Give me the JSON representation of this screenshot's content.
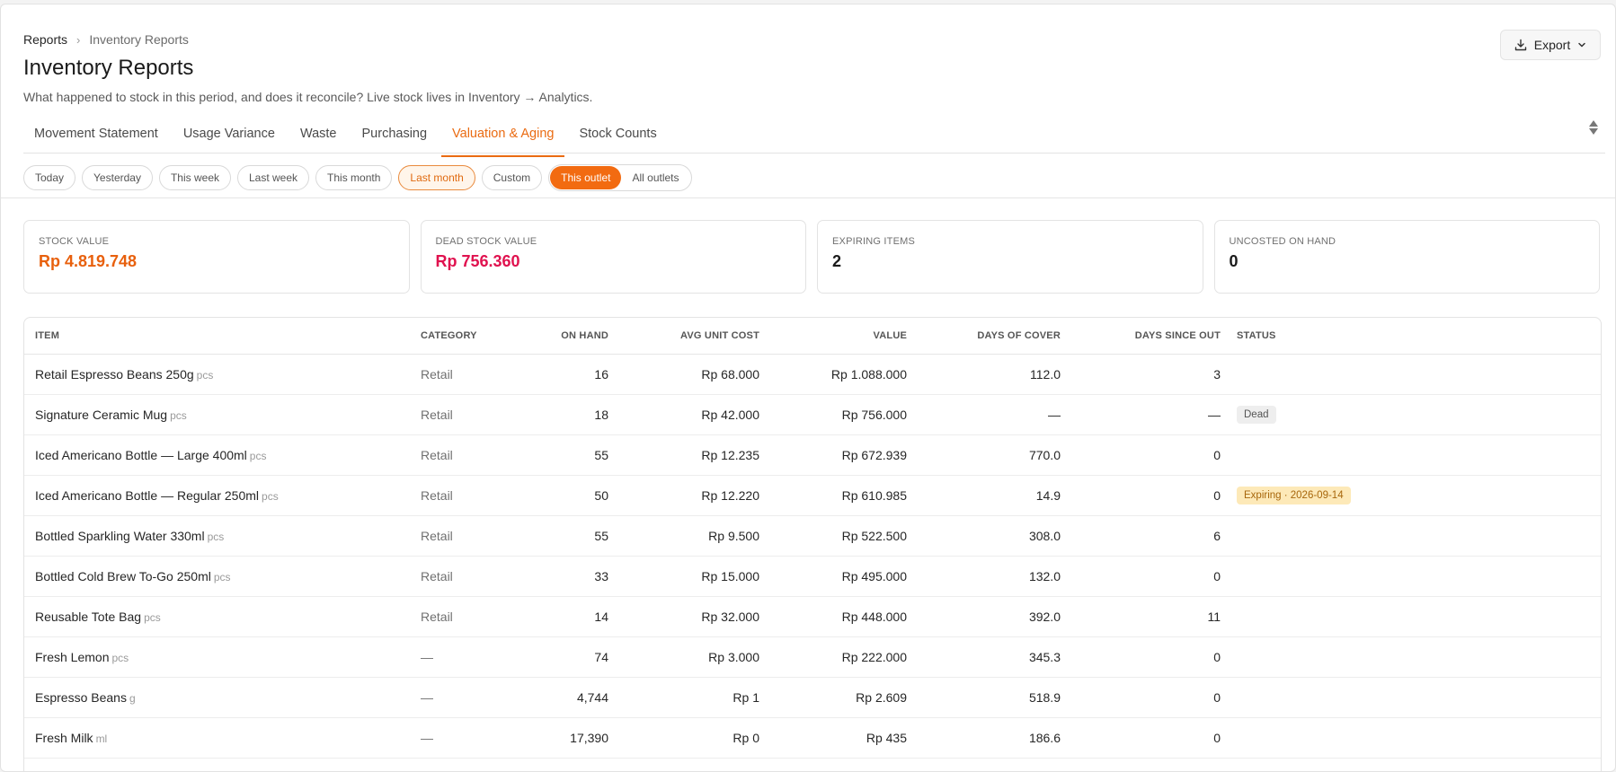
{
  "breadcrumb": {
    "parent": "Reports",
    "current": "Inventory Reports"
  },
  "page": {
    "title": "Inventory Reports",
    "subtitle": "What happened to stock in this period, and does it reconcile? Live stock lives in Inventory → Analytics."
  },
  "export": {
    "label": "Export",
    "icon": "download-icon"
  },
  "tabs": [
    {
      "label": "Movement Statement",
      "active": false
    },
    {
      "label": "Usage Variance",
      "active": false
    },
    {
      "label": "Waste",
      "active": false
    },
    {
      "label": "Purchasing",
      "active": false
    },
    {
      "label": "Valuation & Aging",
      "active": true
    },
    {
      "label": "Stock Counts",
      "active": false
    }
  ],
  "date_filters": [
    {
      "label": "Today",
      "selected": false
    },
    {
      "label": "Yesterday",
      "selected": false
    },
    {
      "label": "This week",
      "selected": false
    },
    {
      "label": "Last week",
      "selected": false
    },
    {
      "label": "This month",
      "selected": false
    },
    {
      "label": "Last month",
      "selected": true
    },
    {
      "label": "Custom",
      "selected": false
    }
  ],
  "scope": [
    {
      "label": "This outlet",
      "active": true
    },
    {
      "label": "All outlets",
      "active": false
    }
  ],
  "kpis": [
    {
      "label": "STOCK VALUE",
      "value": "Rp 4.819.748",
      "color": "#e8600d"
    },
    {
      "label": "DEAD STOCK VALUE",
      "value": "Rp 756.360",
      "color": "#e0124f"
    },
    {
      "label": "EXPIRING ITEMS",
      "value": "2",
      "color": "#1a1a1a"
    },
    {
      "label": "UNCOSTED ON HAND",
      "value": "0",
      "color": "#1a1a1a"
    }
  ],
  "table": {
    "columns": {
      "item": "ITEM",
      "category": "CATEGORY",
      "on_hand": "ON HAND",
      "avg_unit_cost": "AVG UNIT COST",
      "value": "VALUE",
      "days_of_cover": "DAYS OF COVER",
      "days_since_out": "DAYS SINCE OUT",
      "status": "STATUS"
    },
    "rows": [
      {
        "item": "Retail Espresso Beans 250g",
        "unit": "pcs",
        "category": "Retail",
        "on_hand": "16",
        "avg_unit_cost": "Rp 68.000",
        "value": "Rp 1.088.000",
        "days_of_cover": "112.0",
        "days_since_out": "3",
        "status": "",
        "status_type": ""
      },
      {
        "item": "Signature Ceramic Mug",
        "unit": "pcs",
        "category": "Retail",
        "on_hand": "18",
        "avg_unit_cost": "Rp 42.000",
        "value": "Rp 756.000",
        "days_of_cover": "—",
        "days_since_out": "—",
        "status": "Dead",
        "status_type": "dead"
      },
      {
        "item": "Iced Americano Bottle — Large 400ml",
        "unit": "pcs",
        "category": "Retail",
        "on_hand": "55",
        "avg_unit_cost": "Rp 12.235",
        "value": "Rp 672.939",
        "days_of_cover": "770.0",
        "days_since_out": "0",
        "status": "",
        "status_type": ""
      },
      {
        "item": "Iced Americano Bottle — Regular 250ml",
        "unit": "pcs",
        "category": "Retail",
        "on_hand": "50",
        "avg_unit_cost": "Rp 12.220",
        "value": "Rp 610.985",
        "days_of_cover": "14.9",
        "days_since_out": "0",
        "status": "Expiring · 2026-09-14",
        "status_type": "expiring"
      },
      {
        "item": "Bottled Sparkling Water 330ml",
        "unit": "pcs",
        "category": "Retail",
        "on_hand": "55",
        "avg_unit_cost": "Rp 9.500",
        "value": "Rp 522.500",
        "days_of_cover": "308.0",
        "days_since_out": "6",
        "status": "",
        "status_type": ""
      },
      {
        "item": "Bottled Cold Brew To-Go 250ml",
        "unit": "pcs",
        "category": "Retail",
        "on_hand": "33",
        "avg_unit_cost": "Rp 15.000",
        "value": "Rp 495.000",
        "days_of_cover": "132.0",
        "days_since_out": "0",
        "status": "",
        "status_type": ""
      },
      {
        "item": "Reusable Tote Bag",
        "unit": "pcs",
        "category": "Retail",
        "on_hand": "14",
        "avg_unit_cost": "Rp 32.000",
        "value": "Rp 448.000",
        "days_of_cover": "392.0",
        "days_since_out": "11",
        "status": "",
        "status_type": ""
      },
      {
        "item": "Fresh Lemon",
        "unit": "pcs",
        "category": "—",
        "on_hand": "74",
        "avg_unit_cost": "Rp 3.000",
        "value": "Rp 222.000",
        "days_of_cover": "345.3",
        "days_since_out": "0",
        "status": "",
        "status_type": ""
      },
      {
        "item": "Espresso Beans",
        "unit": "g",
        "category": "—",
        "on_hand": "4,744",
        "avg_unit_cost": "Rp 1",
        "value": "Rp 2.609",
        "days_of_cover": "518.9",
        "days_since_out": "0",
        "status": "",
        "status_type": ""
      },
      {
        "item": "Fresh Milk",
        "unit": "ml",
        "category": "—",
        "on_hand": "17,390",
        "avg_unit_cost": "Rp 0",
        "value": "Rp 435",
        "days_of_cover": "186.6",
        "days_since_out": "0",
        "status": "",
        "status_type": ""
      }
    ]
  }
}
